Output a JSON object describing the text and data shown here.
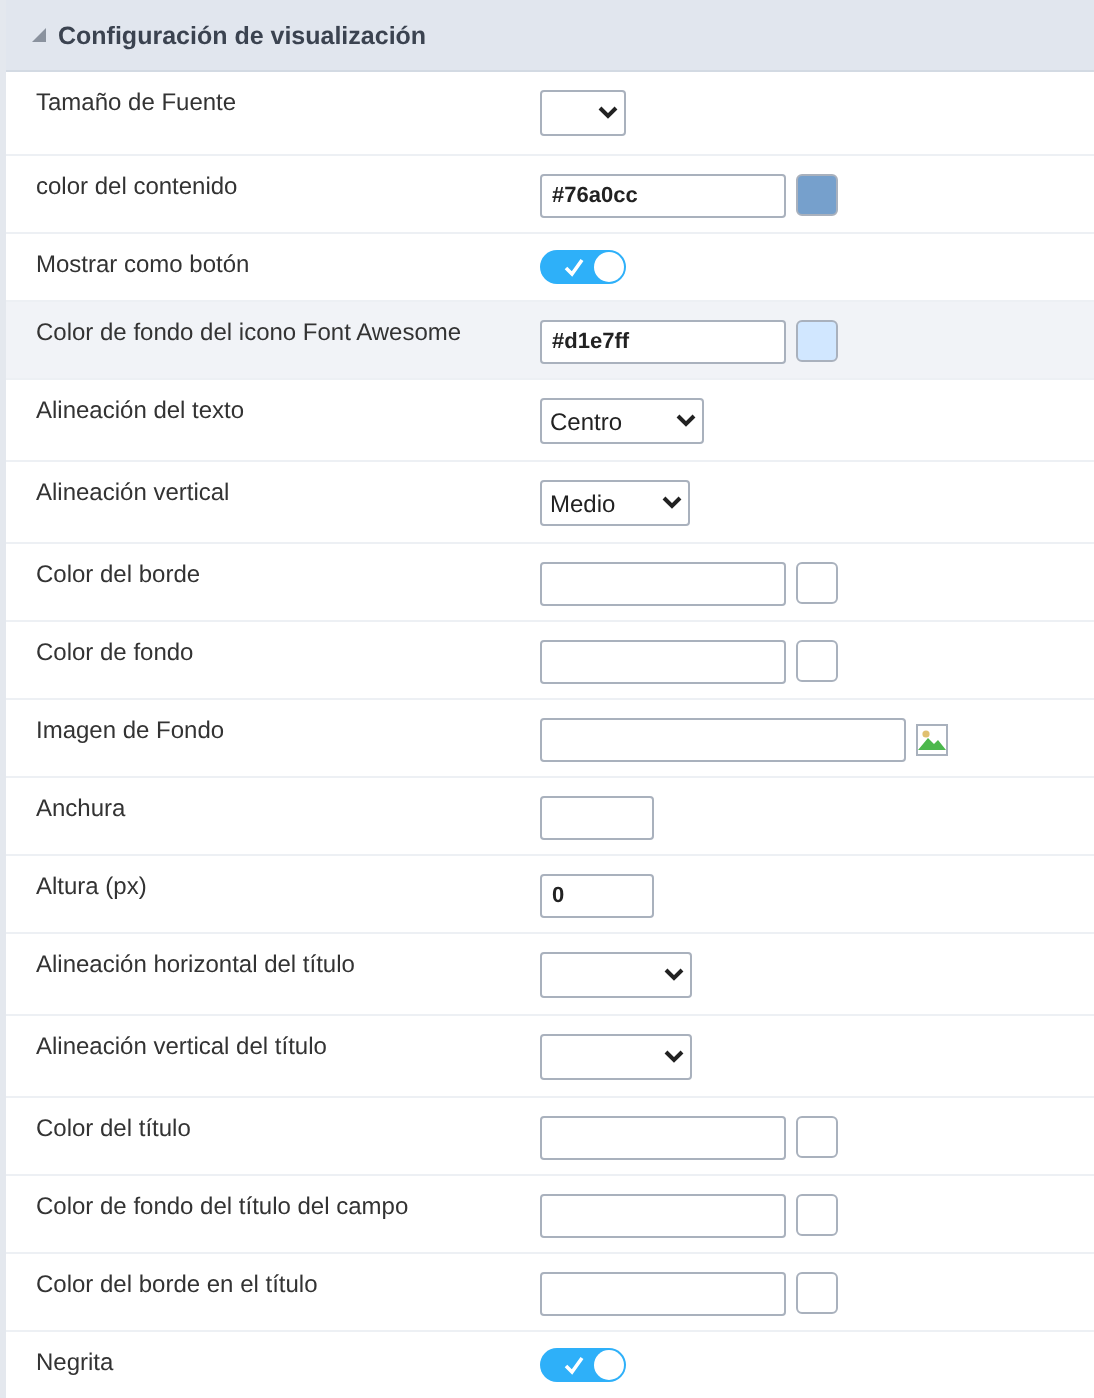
{
  "section": {
    "title": "Configuración de visualización",
    "expanded": true
  },
  "rows": [
    {
      "label": "Tamaño de Fuente",
      "kind": "select",
      "value": "",
      "highlighted": false
    },
    {
      "label": "color del contenido",
      "kind": "color",
      "value": "#76a0cc",
      "highlighted": false
    },
    {
      "label": "Mostrar como botón",
      "kind": "toggle",
      "on": true,
      "highlighted": false
    },
    {
      "label": "Color de fondo del icono Font Awesome",
      "kind": "color",
      "value": "#d1e7ff",
      "highlighted": true
    },
    {
      "label": "Alineación del texto",
      "kind": "select",
      "value": "Centro",
      "highlighted": false
    },
    {
      "label": "Alineación vertical",
      "kind": "select",
      "value": "Medio",
      "highlighted": false
    },
    {
      "label": "Color del borde",
      "kind": "color",
      "value": "",
      "highlighted": false
    },
    {
      "label": "Color de fondo",
      "kind": "color",
      "value": "",
      "highlighted": false
    },
    {
      "label": "Imagen de Fondo",
      "kind": "image",
      "value": "",
      "highlighted": false
    },
    {
      "label": "Anchura",
      "kind": "text",
      "value": "",
      "highlighted": false
    },
    {
      "label": "Altura (px)",
      "kind": "text",
      "value": "0",
      "highlighted": false
    },
    {
      "label": "Alineación horizontal del título",
      "kind": "select",
      "value": "",
      "highlighted": false
    },
    {
      "label": "Alineación vertical del título",
      "kind": "select",
      "value": "",
      "highlighted": false
    },
    {
      "label": "Color del título",
      "kind": "color",
      "value": "",
      "highlighted": false
    },
    {
      "label": "Color de fondo del título del campo",
      "kind": "color",
      "value": "",
      "highlighted": false
    },
    {
      "label": "Color del borde en el título",
      "kind": "color",
      "value": "",
      "highlighted": false
    },
    {
      "label": "Negrita",
      "kind": "toggle",
      "on": true,
      "highlighted": false
    }
  ]
}
